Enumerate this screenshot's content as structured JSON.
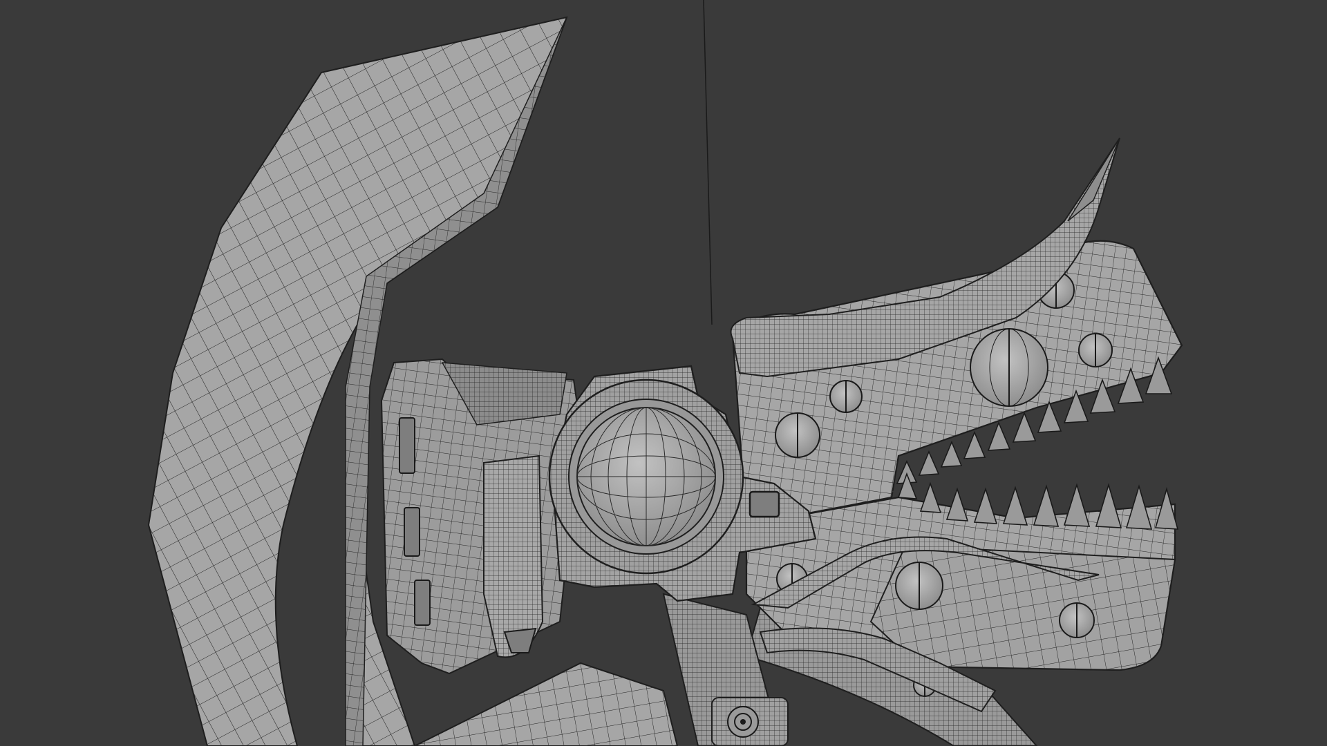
{
  "viewport": {
    "background": "#3a3a3a",
    "mesh_fill": "#a3a3a3",
    "mesh_fill_shadow": "#8e8e8e",
    "wire_color": "#1e1e1e",
    "shading_mode": "wireframe-over-solid"
  },
  "model": {
    "parts": [
      "curved-blade-arm",
      "back-armor-plate",
      "eye-socket-ring",
      "eye-sphere",
      "dragon-head",
      "upper-horn",
      "lower-horn",
      "upper-teeth",
      "lower-teeth",
      "head-bolts",
      "neck-tubes",
      "base-joint"
    ]
  }
}
